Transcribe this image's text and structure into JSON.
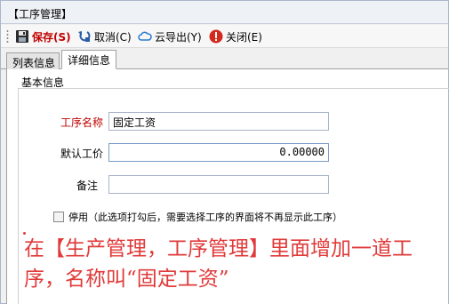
{
  "window": {
    "title": "【工序管理】"
  },
  "toolbar": {
    "save_label": "保存(S)",
    "cancel_label": "取消(C)",
    "export_label": "云导出(Y)",
    "close_label": "关闭(E)"
  },
  "tabs": [
    {
      "label": "列表信息",
      "active": false
    },
    {
      "label": "详细信息",
      "active": true
    }
  ],
  "form": {
    "group_title": "基本信息",
    "name_label": "工序名称",
    "name_value": "固定工资",
    "price_label": "默认工价",
    "price_value": "0.00000",
    "note_label": "备注",
    "note_value": "",
    "disable_label": "停用（此选项打勾后，需要选择工序的界面将不再显示此工序）",
    "disable_checked": false
  },
  "annotation": {
    "text": "在【生产管理，工序管理】里面增加一道工序，名称叫“固定工资”"
  },
  "colors": {
    "required_label": "#c00000",
    "annotation": "#e03a3a",
    "save_label": "#c00000"
  },
  "icons": [
    "save-icon",
    "cancel-icon",
    "cloud-export-icon",
    "close-icon"
  ]
}
